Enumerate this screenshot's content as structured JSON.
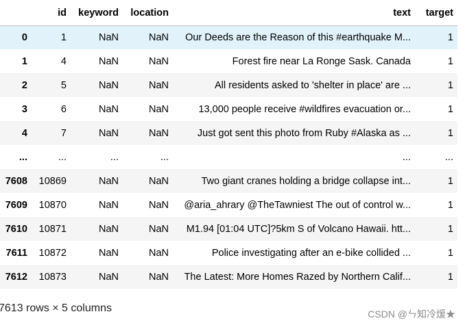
{
  "columns": {
    "index": "",
    "id": "id",
    "keyword": "keyword",
    "location": "location",
    "text": "text",
    "target": "target"
  },
  "rows": [
    {
      "index": "0",
      "id": "1",
      "keyword": "NaN",
      "location": "NaN",
      "text": "Our Deeds are the Reason of this #earthquake M...",
      "target": "1"
    },
    {
      "index": "1",
      "id": "4",
      "keyword": "NaN",
      "location": "NaN",
      "text": "Forest fire near La Ronge Sask. Canada",
      "target": "1"
    },
    {
      "index": "2",
      "id": "5",
      "keyword": "NaN",
      "location": "NaN",
      "text": "All residents asked to 'shelter in place' are ...",
      "target": "1"
    },
    {
      "index": "3",
      "id": "6",
      "keyword": "NaN",
      "location": "NaN",
      "text": "13,000 people receive #wildfires evacuation or...",
      "target": "1"
    },
    {
      "index": "4",
      "id": "7",
      "keyword": "NaN",
      "location": "NaN",
      "text": "Just got sent this photo from Ruby #Alaska as ...",
      "target": "1"
    },
    {
      "index": "...",
      "id": "...",
      "keyword": "...",
      "location": "...",
      "text": "...",
      "target": "..."
    },
    {
      "index": "7608",
      "id": "10869",
      "keyword": "NaN",
      "location": "NaN",
      "text": "Two giant cranes holding a bridge collapse int...",
      "target": "1"
    },
    {
      "index": "7609",
      "id": "10870",
      "keyword": "NaN",
      "location": "NaN",
      "text": "@aria_ahrary @TheTawniest The out of control w...",
      "target": "1"
    },
    {
      "index": "7610",
      "id": "10871",
      "keyword": "NaN",
      "location": "NaN",
      "text": "M1.94 [01:04 UTC]?5km S of Volcano Hawaii. htt...",
      "target": "1"
    },
    {
      "index": "7611",
      "id": "10872",
      "keyword": "NaN",
      "location": "NaN",
      "text": "Police investigating after an e-bike collided ...",
      "target": "1"
    },
    {
      "index": "7612",
      "id": "10873",
      "keyword": "NaN",
      "location": "NaN",
      "text": "The Latest: More Homes Razed by Northern Calif...",
      "target": "1"
    }
  ],
  "shape_text": "7613 rows × 5 columns",
  "watermark": "CSDN @ㄣ知冷煖★",
  "colors": {
    "row_odd": "#f5f5f5",
    "row_even": "#ffffff",
    "row_hover": "#e1f2fb"
  }
}
